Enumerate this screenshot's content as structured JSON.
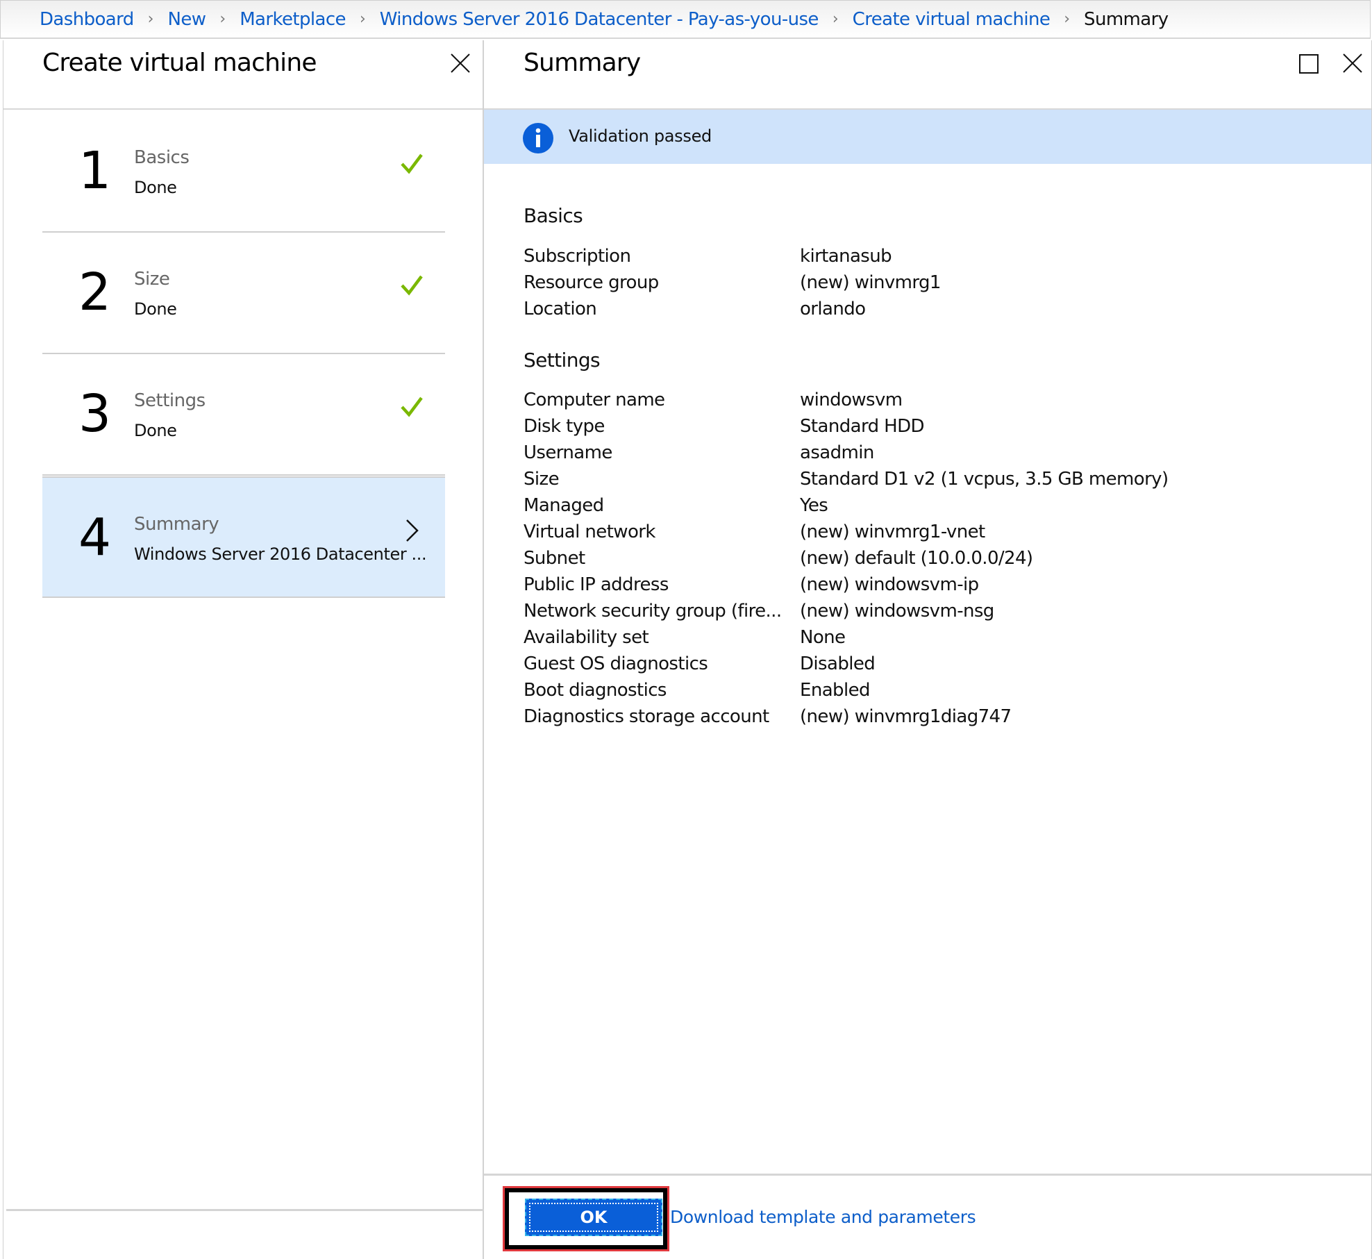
{
  "breadcrumb": {
    "items": [
      {
        "label": "Dashboard"
      },
      {
        "label": "New"
      },
      {
        "label": "Marketplace"
      },
      {
        "label": "Windows Server 2016 Datacenter - Pay-as-you-use"
      },
      {
        "label": "Create virtual machine"
      },
      {
        "label": "Summary"
      }
    ],
    "separator": "›"
  },
  "left_pane": {
    "title": "Create virtual machine",
    "steps": [
      {
        "number": "1",
        "title": "Basics",
        "subtitle": "Done",
        "status": "done"
      },
      {
        "number": "2",
        "title": "Size",
        "subtitle": "Done",
        "status": "done"
      },
      {
        "number": "3",
        "title": "Settings",
        "subtitle": "Done",
        "status": "done"
      },
      {
        "number": "4",
        "title": "Summary",
        "subtitle": "Windows Server 2016 Datacenter ...",
        "status": "active"
      }
    ]
  },
  "right_pane": {
    "title": "Summary",
    "info_message": "Validation passed",
    "sections": [
      {
        "title": "Basics",
        "rows": [
          {
            "label": "Subscription",
            "value": "kirtanasub"
          },
          {
            "label": "Resource group",
            "value": "(new) winvmrg1"
          },
          {
            "label": "Location",
            "value": "orlando"
          }
        ]
      },
      {
        "title": "Settings",
        "rows": [
          {
            "label": "Computer name",
            "value": "windowsvm"
          },
          {
            "label": "Disk type",
            "value": "Standard HDD"
          },
          {
            "label": "Username",
            "value": "asadmin"
          },
          {
            "label": "Size",
            "value": "Standard D1 v2 (1 vcpus, 3.5 GB memory)"
          },
          {
            "label": "Managed",
            "value": "Yes"
          },
          {
            "label": "Virtual network",
            "value": "(new) winvmrg1-vnet"
          },
          {
            "label": "Subnet",
            "value": "(new) default (10.0.0.0/24)"
          },
          {
            "label": "Public IP address",
            "value": "(new) windowsvm-ip"
          },
          {
            "label": "Network security group (fire...",
            "value": "(new) windowsvm-nsg"
          },
          {
            "label": "Availability set",
            "value": "None"
          },
          {
            "label": "Guest OS diagnostics",
            "value": "Disabled"
          },
          {
            "label": "Boot diagnostics",
            "value": "Enabled"
          },
          {
            "label": "Diagnostics storage account",
            "value": "(new) winvmrg1diag747"
          }
        ]
      }
    ],
    "footer": {
      "ok_label": "OK",
      "download_label": "Download template and parameters"
    }
  },
  "colors": {
    "link": "#0d5ec9",
    "check": "#7ab800",
    "info_bg": "#cfe3fb",
    "info_icon": "#0a5fd8",
    "active_step_bg": "#dcecfc",
    "ok_button": "#0a5fd8",
    "highlight_frame": "#e0393e"
  }
}
